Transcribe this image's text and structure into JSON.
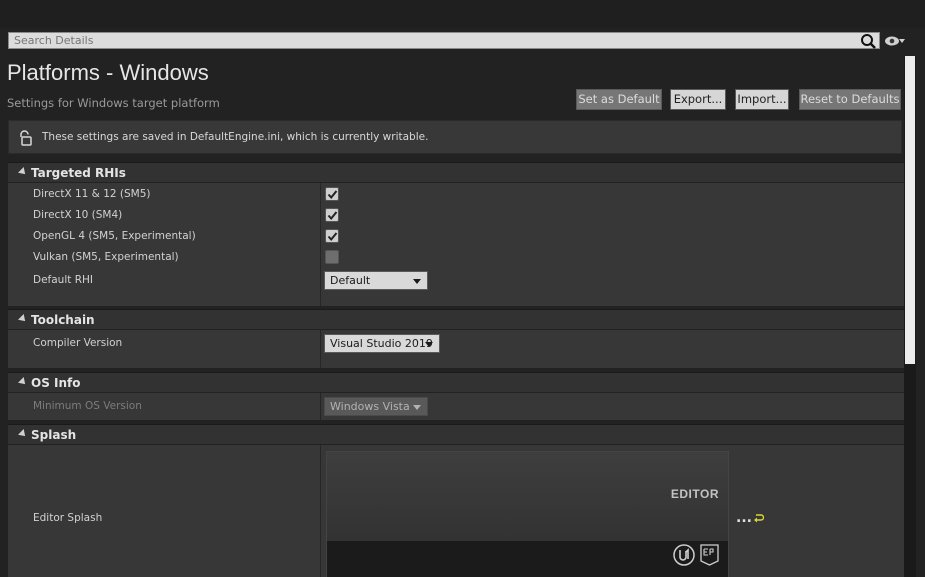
{
  "search": {
    "placeholder": "Search Details"
  },
  "header": {
    "title": "Platforms - Windows",
    "subtitle": "Settings for Windows target platform",
    "buttons": {
      "set_default": "Set as Default",
      "export": "Export...",
      "import": "Import...",
      "reset": "Reset to Defaults"
    }
  },
  "notice": {
    "text": "These settings are saved in DefaultEngine.ini, which is currently writable."
  },
  "categories": {
    "targeted_rhis": {
      "label": "Targeted RHIs",
      "rows": [
        {
          "label": "DirectX 11 & 12 (SM5)",
          "checked": true
        },
        {
          "label": "DirectX 10 (SM4)",
          "checked": true
        },
        {
          "label": "OpenGL 4 (SM5, Experimental)",
          "checked": true
        },
        {
          "label": "Vulkan (SM5, Experimental)",
          "checked": false
        }
      ],
      "default_rhi": {
        "label": "Default RHI",
        "value": "Default"
      }
    },
    "toolchain": {
      "label": "Toolchain",
      "compiler": {
        "label": "Compiler Version",
        "value": "Visual Studio 2019"
      }
    },
    "os_info": {
      "label": "OS Info",
      "min_os": {
        "label": "Minimum OS Version",
        "value": "Windows Vista"
      }
    },
    "splash": {
      "label": "Splash",
      "editor_splash": {
        "label": "Editor Splash",
        "image_text": "EDITOR",
        "more": "..."
      }
    }
  },
  "icons": {
    "search": "search-icon",
    "eye": "eye-icon",
    "lock": "lock-icon",
    "reset": "reset-arrow-icon"
  },
  "colors": {
    "background": "#222222",
    "panel": "#373737",
    "category": "#323232",
    "button": "#d6d6d6"
  }
}
